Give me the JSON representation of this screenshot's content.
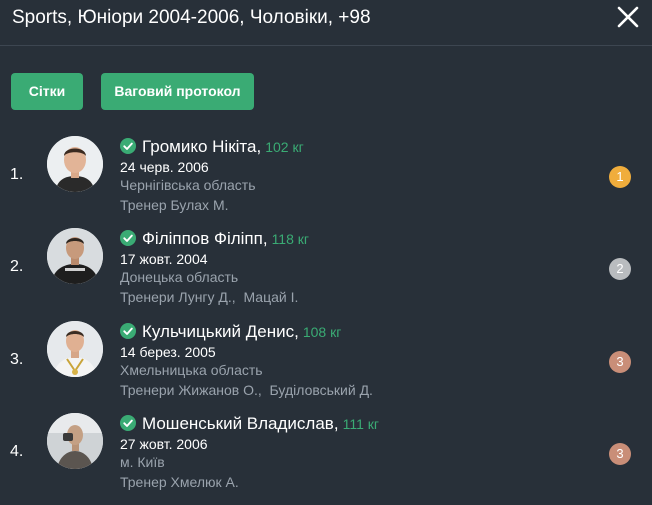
{
  "header": {
    "title": "Sports, Юніори 2004-2006, Чоловіки, +98"
  },
  "toolbar": {
    "grids_label": "Сітки",
    "weigh_label": "Ваговий протокол"
  },
  "athletes": [
    {
      "place": "1.",
      "name": "Громико Нікіта",
      "weight": "102 кг",
      "dob": "24 черв. 2006",
      "region": "Чернігівська область",
      "coach": "Тренер Булах М.",
      "medal": "1",
      "medal_color": "#f0ad3c"
    },
    {
      "place": "2.",
      "name": "Філіппов Філіпп",
      "weight": "118 кг",
      "dob": "17 жовт. 2004",
      "region": "Донецька область",
      "coach": "Тренери Лунгу Д.,  Мацай І.",
      "medal": "2",
      "medal_color": "#b9bcbf"
    },
    {
      "place": "3.",
      "name": "Кульчицький Денис",
      "weight": "108 кг",
      "dob": "14 берез. 2005",
      "region": "Хмельницька область",
      "coach": "Тренери Жижанов О.,  Буділовський Д.",
      "medal": "3",
      "medal_color": "#c98e78"
    },
    {
      "place": "4.",
      "name": "Мошенський Владислав",
      "weight": "111 кг",
      "dob": "27 жовт. 2006",
      "region": "м. Київ",
      "coach": "Тренер Хмелюк А.",
      "medal": "3",
      "medal_color": "#c98e78"
    }
  ],
  "icons": {
    "close": "close-icon",
    "verified": "check-circle-icon"
  },
  "colors": {
    "background": "#283039",
    "accent": "#3aab74",
    "muted": "#9aa3ad"
  }
}
